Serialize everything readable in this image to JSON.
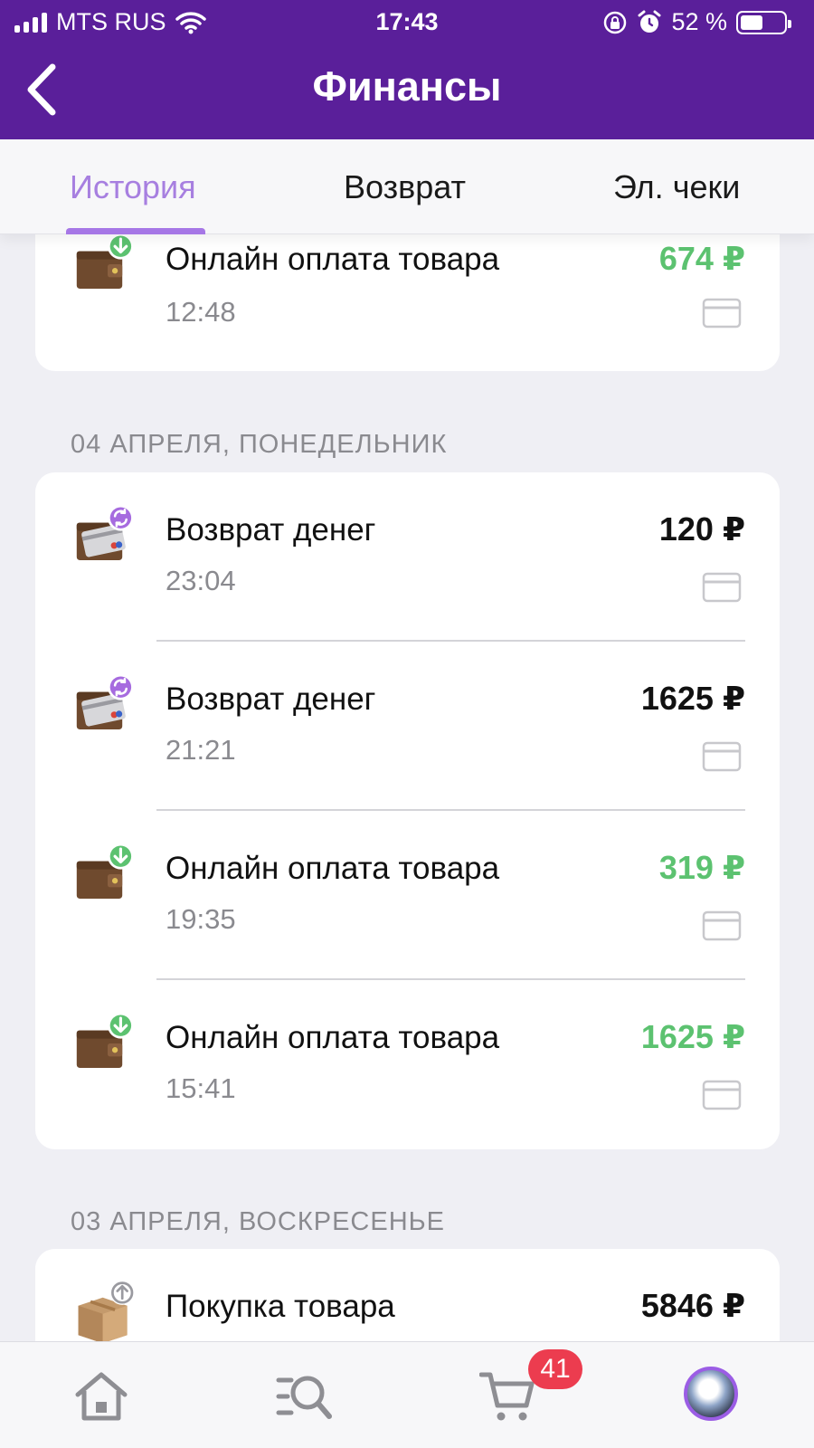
{
  "status_bar": {
    "carrier": "MTS RUS",
    "time": "17:43",
    "battery": "52 %"
  },
  "header": {
    "title": "Финансы",
    "back_icon": "chevron-left-icon"
  },
  "tabs": [
    {
      "label": "История",
      "active": true
    },
    {
      "label": "Возврат",
      "active": false
    },
    {
      "label": "Эл. чеки",
      "active": false
    }
  ],
  "colors": {
    "brand": "#5a1f9a",
    "accent": "#a677e6",
    "positive": "#5cc270",
    "badge": "#ec3c4f"
  },
  "top_partial_item": {
    "title": "Онлайн оплата товара",
    "time": "12:48",
    "amount": "674 ₽",
    "type": "payment"
  },
  "groups": [
    {
      "date": "04 АПРЕЛЯ, ПОНЕДЕЛЬНИК",
      "items": [
        {
          "title": "Возврат денег",
          "time": "23:04",
          "amount": "120 ₽",
          "type": "refund"
        },
        {
          "title": "Возврат денег",
          "time": "21:21",
          "amount": "1625 ₽",
          "type": "refund"
        },
        {
          "title": "Онлайн оплата товара",
          "time": "19:35",
          "amount": "319 ₽",
          "type": "payment"
        },
        {
          "title": "Онлайн оплата товара",
          "time": "15:41",
          "amount": "1625 ₽",
          "type": "payment"
        }
      ]
    },
    {
      "date": "03 АПРЕЛЯ, ВОСКРЕСЕНЬЕ",
      "items": [
        {
          "title": "Покупка товара",
          "amount": "5846 ₽",
          "type": "purchase"
        }
      ]
    }
  ],
  "bottom_nav": {
    "items": [
      "home-icon",
      "search-catalog-icon",
      "cart-icon",
      "profile-avatar"
    ],
    "cart_badge": "41"
  }
}
